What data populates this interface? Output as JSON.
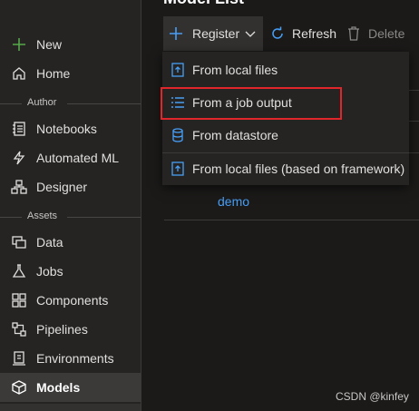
{
  "sidebar": {
    "new_label": "New",
    "home_label": "Home",
    "author_header": "Author",
    "author_items": [
      {
        "label": "Notebooks",
        "icon": "notebook-icon"
      },
      {
        "label": "Automated ML",
        "icon": "automated-ml-icon"
      },
      {
        "label": "Designer",
        "icon": "designer-icon"
      }
    ],
    "assets_header": "Assets",
    "assets_items": [
      {
        "label": "Data",
        "icon": "data-icon"
      },
      {
        "label": "Jobs",
        "icon": "jobs-flask-icon"
      },
      {
        "label": "Components",
        "icon": "components-icon"
      },
      {
        "label": "Pipelines",
        "icon": "pipelines-icon"
      },
      {
        "label": "Environments",
        "icon": "environments-icon"
      },
      {
        "label": "Models",
        "icon": "models-cube-icon",
        "active": true
      }
    ]
  },
  "main": {
    "title": "Model List",
    "toolbar": {
      "register_label": "Register",
      "refresh_label": "Refresh",
      "delete_label": "Delete"
    },
    "register_menu": [
      {
        "label": "From local files",
        "icon": "upload-file-icon"
      },
      {
        "label": "From a job output",
        "icon": "list-icon"
      },
      {
        "label": "From datastore",
        "icon": "datastore-icon"
      },
      {
        "label": "From local files (based on framework)",
        "icon": "upload-file-icon"
      }
    ],
    "table_link": "demo"
  },
  "watermark": "CSDN @kinfey",
  "colors": {
    "accent": "#479ef5",
    "new_plus": "#57a64a",
    "highlight": "#e0262b"
  }
}
